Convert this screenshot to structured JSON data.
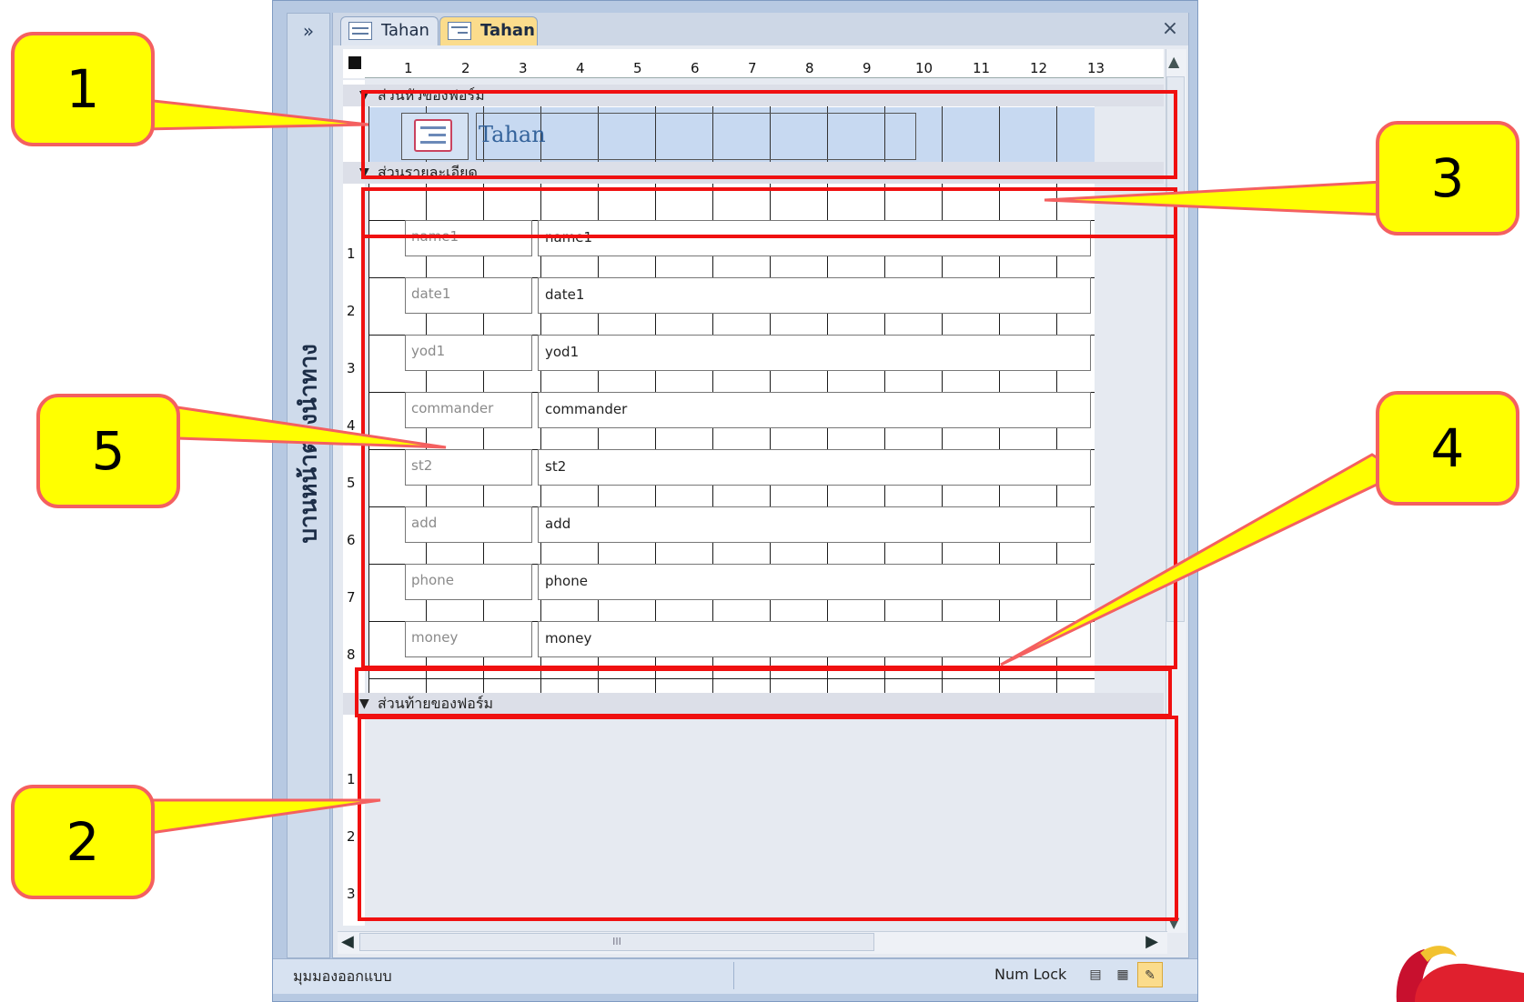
{
  "window": {
    "nav_toggle": "»",
    "nav_title": "บานหน้าต่างนำทาง",
    "tabs": [
      {
        "label": "Tahan",
        "active": false,
        "icon": "table-icon"
      },
      {
        "label": "Tahan",
        "active": true,
        "icon": "form-icon"
      }
    ],
    "close": "×"
  },
  "ruler": {
    "horizontal": [
      "1",
      "2",
      "3",
      "4",
      "5",
      "6",
      "7",
      "8",
      "9",
      "10",
      "11",
      "12",
      "13"
    ],
    "vertical_detail": [
      "1",
      "2",
      "3",
      "4",
      "5",
      "6",
      "7",
      "8"
    ],
    "vertical_footer": [
      "1",
      "2",
      "3"
    ]
  },
  "form": {
    "header_section": "ส่วนหัวของฟอร์ม",
    "detail_section": "ส่วนรายละเอียด",
    "footer_section": "ส่วนท้ายของฟอร์ม",
    "title": "Tahan",
    "fields": [
      {
        "label": "name1",
        "value": "name1"
      },
      {
        "label": "date1",
        "value": "date1"
      },
      {
        "label": "yod1",
        "value": "yod1"
      },
      {
        "label": "commander",
        "value": "commander"
      },
      {
        "label": "st2",
        "value": "st2"
      },
      {
        "label": "add",
        "value": "add"
      },
      {
        "label": "phone",
        "value": "phone"
      },
      {
        "label": "money",
        "value": "money"
      }
    ]
  },
  "hscroll_grip": "III",
  "statusbar": {
    "view": "มุมมองออกแบบ",
    "numlock": "Num Lock"
  },
  "callouts": [
    "1",
    "2",
    "3",
    "4",
    "5"
  ],
  "colors": {
    "annotation_red": "#f01010",
    "callout_fill": "#ffff00",
    "header_fill": "#c7d9f1",
    "active_tab": "#fbdc8c"
  }
}
